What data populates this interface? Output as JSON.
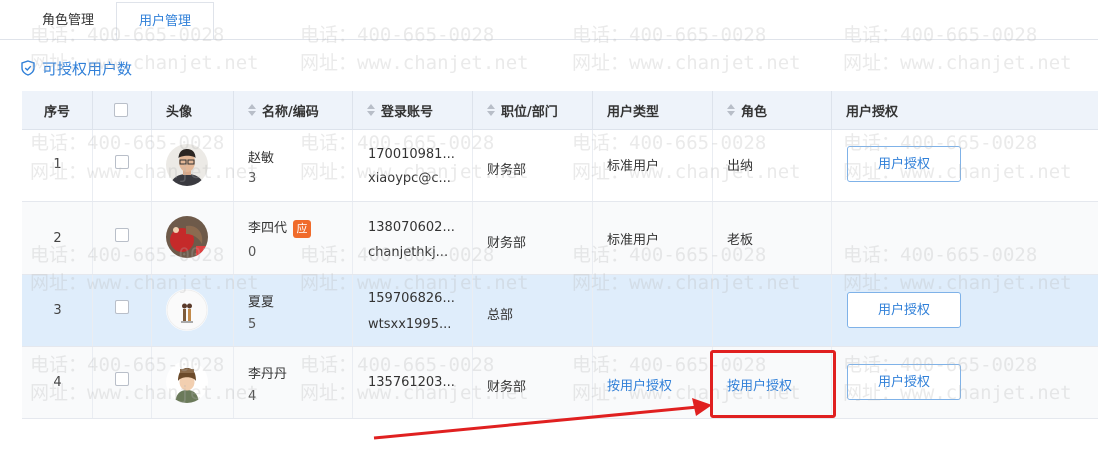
{
  "tabs": [
    {
      "label": "角色管理",
      "active": false
    },
    {
      "label": "用户管理",
      "active": true
    }
  ],
  "section": {
    "title": "可授权用户数",
    "icon": "shield-check-icon"
  },
  "table": {
    "headers": {
      "seq": "序号",
      "avatar": "头像",
      "name": "名称/编码",
      "account": "登录账号",
      "dept": "职位/部门",
      "user_type": "用户类型",
      "role": "角色",
      "auth": "用户授权"
    },
    "rows": [
      {
        "seq": "1",
        "name": "赵敏",
        "code": "3",
        "badge": "",
        "account1": "170010981...",
        "account2": "xiaoypc@c...",
        "dept": "财务部",
        "user_type": "标准用户",
        "user_type_link": false,
        "role": "出纳",
        "role_link": false,
        "auth_button": "用户授权"
      },
      {
        "seq": "2",
        "name": "李四代",
        "code": "0",
        "badge": "应",
        "account1": "138070602...",
        "account2": "chanjethkj...",
        "dept": "财务部",
        "user_type": "标准用户",
        "user_type_link": false,
        "role": "老板",
        "role_link": false,
        "auth_button": ""
      },
      {
        "seq": "3",
        "name": "夏夏",
        "code": "5",
        "badge": "",
        "account1": "159706826...",
        "account2": "wtsxx1995...",
        "dept": "总部",
        "user_type": "",
        "user_type_link": false,
        "role": "",
        "role_link": false,
        "auth_button": "用户授权"
      },
      {
        "seq": "4",
        "name": "李丹丹",
        "code": "4",
        "badge": "",
        "account1": "135761203...",
        "account2": "",
        "dept": "财务部",
        "user_type": "按用户授权",
        "user_type_link": true,
        "role": "按用户授权",
        "role_link": true,
        "auth_button": "用户授权"
      }
    ]
  },
  "watermark": {
    "phone": "电话：400-665-0028",
    "site": "网址：www.chanjet.net"
  },
  "colors": {
    "accent": "#2f7fd8",
    "header_bg": "#eef3fa",
    "selected_row": "#dfedfb",
    "annotation": "#e02020",
    "badge": "#f06b2b"
  }
}
